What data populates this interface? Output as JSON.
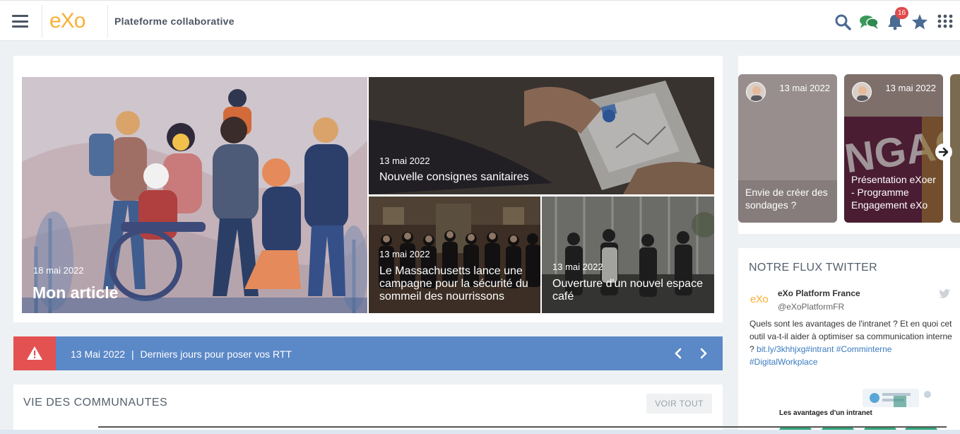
{
  "header": {
    "logo_text": "eXo",
    "title": "Plateforme collaborative",
    "notifications_count": "16",
    "icons": [
      "hamburger-icon",
      "search-icon",
      "chat-icon",
      "bell-icon",
      "star-icon",
      "apps-grid-icon"
    ]
  },
  "news": [
    {
      "date": "18 mai 2022",
      "title": "Mon article"
    },
    {
      "date": "13 mai 2022",
      "title": "Nouvelle consignes sanitaires"
    },
    {
      "date": "13 mai 2022",
      "title": "Le Massachusetts lance une campagne pour la sécurité du sommeil des nourrissons"
    },
    {
      "date": "13 mai 2022",
      "title": "Ouverture d'un nouvel espace café"
    }
  ],
  "alert": {
    "date": "13 Mai 2022",
    "separator": "|",
    "text": "Derniers jours pour poser vos RTT"
  },
  "communities": {
    "title": "VIE DES COMMUNAUTES",
    "see_all": "VOIR TOUT"
  },
  "side_cards": [
    {
      "date": "13 mai 2022",
      "title": "Envie de créer des sondages ?"
    },
    {
      "date": "13 mai 2022",
      "title": "Présentation eXoer - Programme Engagement eXo"
    }
  ],
  "twitter": {
    "title": "NOTRE FLUX TWITTER",
    "logo_text": "eXo",
    "account_name": "eXo Platform France",
    "handle": "@eXoPlatformFR",
    "text_plain": "Quels sont les avantages de l'intranet ? Et en quoi cet outil va-t-il aider à optimiser sa communication interne ? ",
    "link": "bit.ly/3khhjxg",
    "tags": [
      "#intrant",
      "#Comminterne",
      "#DigitalWorkplace"
    ],
    "card_caption": "Les avantages d'un intranet"
  },
  "colors": {
    "accent_blue": "#5b88c7",
    "alert_red": "#e45151",
    "logo_orange": "#f8b133",
    "chat_green": "#3a9a5b",
    "icon_blue": "#4a6b93"
  }
}
